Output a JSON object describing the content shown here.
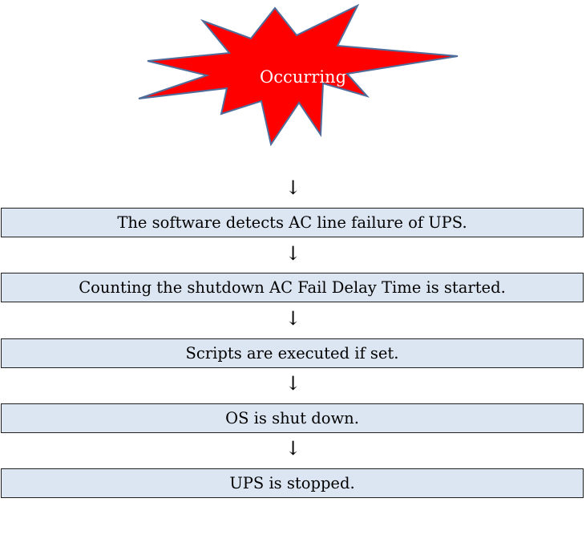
{
  "burst": {
    "label": "Occurring",
    "fill_color": "#ff0000",
    "stroke_color": "#4f6d9b"
  },
  "arrow_glyph": "↓",
  "steps": [
    {
      "label": "The software detects AC line failure of UPS."
    },
    {
      "label": "Counting the shutdown AC Fail Delay Time is started."
    },
    {
      "label": "Scripts are executed if set."
    },
    {
      "label": "OS is shut down."
    },
    {
      "label": "UPS is stopped."
    }
  ],
  "colors": {
    "box_fill": "#dce6f2",
    "box_border": "#1f1f1f"
  }
}
